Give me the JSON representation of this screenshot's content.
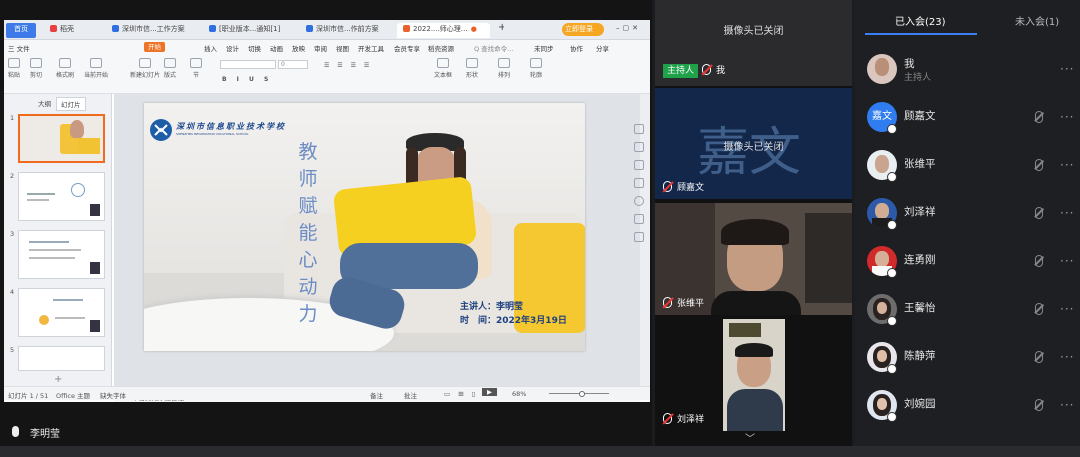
{
  "wps": {
    "tabs": [
      {
        "label": "首页"
      },
      {
        "label": "稻壳"
      },
      {
        "label": "深圳市信...工作方案"
      },
      {
        "label": "[职业版本...通知[1]"
      },
      {
        "label": "深圳市信...作前方案"
      },
      {
        "label": "2022....师心理…"
      }
    ],
    "login_label": "立即登录",
    "menu": [
      "三 文件",
      "开始",
      "插入",
      "设计",
      "切换",
      "动画",
      "放映",
      "审阅",
      "视图",
      "开发工具",
      "会员专享",
      "稻壳资源"
    ],
    "menu_search": "Q 查找命令...",
    "menu_right": [
      "未同步",
      "协作",
      "分享"
    ],
    "ribbon": [
      "粘贴",
      "剪切",
      "复制",
      "格式刷",
      "当前开始",
      "新建幻灯片",
      "版式",
      "节",
      "重置",
      "文本框",
      "形状",
      "排列",
      "轮廓"
    ],
    "font_size_value": "0",
    "pane_tabs": [
      "大纲",
      "幻灯片"
    ],
    "thumbs": [
      "1",
      "2",
      "3",
      "4",
      "5"
    ],
    "slide": {
      "school": "深圳市信息职业技术学校",
      "school_en": "SHENZHEN INFORMATION VOCATIONAL SCHOOL",
      "title_chars": [
        "教",
        "师",
        "赋",
        "能",
        "心",
        "动",
        "力"
      ],
      "speaker_line": "主讲人：李明莹",
      "date_line": "时　间：2022年3月19日"
    },
    "notes_placeholder": "单击此处添加备注",
    "status": {
      "slide_count": "幻灯片 1 / 51",
      "theme": "Office 主题",
      "font_missing": "缺失字体",
      "notes_btn": "备注",
      "comments_btn": "批注",
      "zoom": "68%"
    }
  },
  "speaker_label": "李明莹",
  "videos": [
    {
      "name": "我",
      "host_badge": "主持人",
      "status": "摄像头已关闭"
    },
    {
      "name": "顾嘉文",
      "avatar_text": "嘉文",
      "status": "摄像头已关闭"
    },
    {
      "name": "张维平"
    },
    {
      "name": "刘泽祥"
    }
  ],
  "participants": {
    "tab_joined": "已入会(23)",
    "tab_not_joined": "未入会(1)",
    "list": [
      {
        "name": "我",
        "sub": "主持人",
        "color": "#d9c7bf"
      },
      {
        "name": "顾嘉文",
        "avatar_text": "嘉文",
        "color": "#2f7df0"
      },
      {
        "name": "张维平",
        "color": "#e9eef2"
      },
      {
        "name": "刘泽祥",
        "color": "#2c5aa8"
      },
      {
        "name": "连勇刚",
        "color": "#d02a2a"
      },
      {
        "name": "王馨怡",
        "color": "#6d6d6d"
      },
      {
        "name": "陈静萍",
        "color": "#e8e6ea"
      },
      {
        "name": "刘婉园",
        "color": "#dfe6ef"
      }
    ]
  }
}
